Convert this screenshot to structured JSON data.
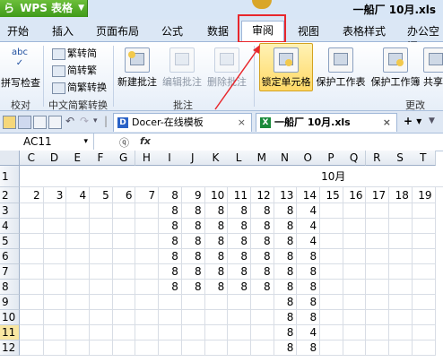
{
  "app": {
    "wps_logo": "ら",
    "wps_label": "WPS 表格",
    "title": "一船厂 10月.xls"
  },
  "menu": {
    "tabs": [
      "开始",
      "插入",
      "页面布局",
      "公式",
      "数据",
      "审阅",
      "视图",
      "表格样式",
      "办公空间"
    ],
    "active_index": 5
  },
  "ribbon": {
    "spellcheck_icon_text": "abc",
    "spellcheck": "拼写检查",
    "proofread_group": "校对",
    "to_traditional": "繁转简",
    "to_simplified": "简转繁",
    "traditional_convert": "简繁转换",
    "chinese_convert_group": "中文简繁转换",
    "new_comment": "新建批注",
    "edit_comment": "编辑批注",
    "delete_comment": "删除批注",
    "comment_group": "批注",
    "lock_cell": "锁定单元格",
    "protect_sheet": "保护工作表",
    "protect_workbook": "保护工作簿",
    "share": "共享",
    "changes_group": "更改"
  },
  "toolbar": {
    "tab_docer": "Docer-在线模板",
    "tab_file": "一船厂  10月.xls",
    "docer_icon_text": "D",
    "file_icon_text": "X",
    "close_glyph": "×",
    "new_tab": "+ ▾"
  },
  "formula": {
    "name_box": "AC11",
    "fx_label": "fx",
    "magnifier": "ⓠ"
  },
  "colors": {
    "accent_red": "#e8272c",
    "wps_green": "#4caf25",
    "active_row_highlight": "#f9e7a2"
  },
  "grid": {
    "columns": [
      "C",
      "D",
      "E",
      "F",
      "G",
      "H",
      "I",
      "J",
      "K",
      "L",
      "M",
      "N",
      "O",
      "P",
      "Q",
      "R",
      "S",
      "T"
    ],
    "rows": [
      "1",
      "2",
      "3",
      "4",
      "5",
      "6",
      "7",
      "8",
      "9",
      "10",
      "11",
      "12"
    ],
    "highlight_row": "11",
    "row1_text": "10月",
    "row2": [
      "2",
      "3",
      "4",
      "5",
      "6",
      "7",
      "8",
      "9",
      "10",
      "11",
      "12",
      "13",
      "14",
      "15",
      "16",
      "17",
      "18",
      "19"
    ],
    "data_rows": [
      [
        "",
        "",
        "",
        "",
        "",
        "",
        "8",
        "8",
        "8",
        "8",
        "8",
        "8",
        "4",
        "",
        "",
        "",
        "",
        ""
      ],
      [
        "",
        "",
        "",
        "",
        "",
        "",
        "8",
        "8",
        "8",
        "8",
        "8",
        "8",
        "4",
        "",
        "",
        "",
        "",
        ""
      ],
      [
        "",
        "",
        "",
        "",
        "",
        "",
        "8",
        "8",
        "8",
        "8",
        "8",
        "8",
        "4",
        "",
        "",
        "",
        "",
        ""
      ],
      [
        "",
        "",
        "",
        "",
        "",
        "",
        "8",
        "8",
        "8",
        "8",
        "8",
        "8",
        "8",
        "",
        "",
        "",
        "",
        ""
      ],
      [
        "",
        "",
        "",
        "",
        "",
        "",
        "8",
        "8",
        "8",
        "8",
        "8",
        "8",
        "8",
        "",
        "",
        "",
        "",
        ""
      ],
      [
        "",
        "",
        "",
        "",
        "",
        "",
        "8",
        "8",
        "8",
        "8",
        "8",
        "8",
        "8",
        "",
        "",
        "",
        "",
        ""
      ],
      [
        "",
        "",
        "",
        "",
        "",
        "",
        "",
        "",
        "",
        "",
        "",
        "8",
        "8",
        "",
        "",
        "",
        "",
        ""
      ],
      [
        "",
        "",
        "",
        "",
        "",
        "",
        "",
        "",
        "",
        "",
        "",
        "8",
        "8",
        "",
        "",
        "",
        "",
        ""
      ],
      [
        "",
        "",
        "",
        "",
        "",
        "",
        "",
        "",
        "",
        "",
        "",
        "8",
        "4",
        "",
        "",
        "",
        "",
        ""
      ],
      [
        "",
        "",
        "",
        "",
        "",
        "",
        "",
        "",
        "",
        "",
        "",
        "8",
        "8",
        "",
        "",
        "",
        "",
        ""
      ]
    ]
  }
}
